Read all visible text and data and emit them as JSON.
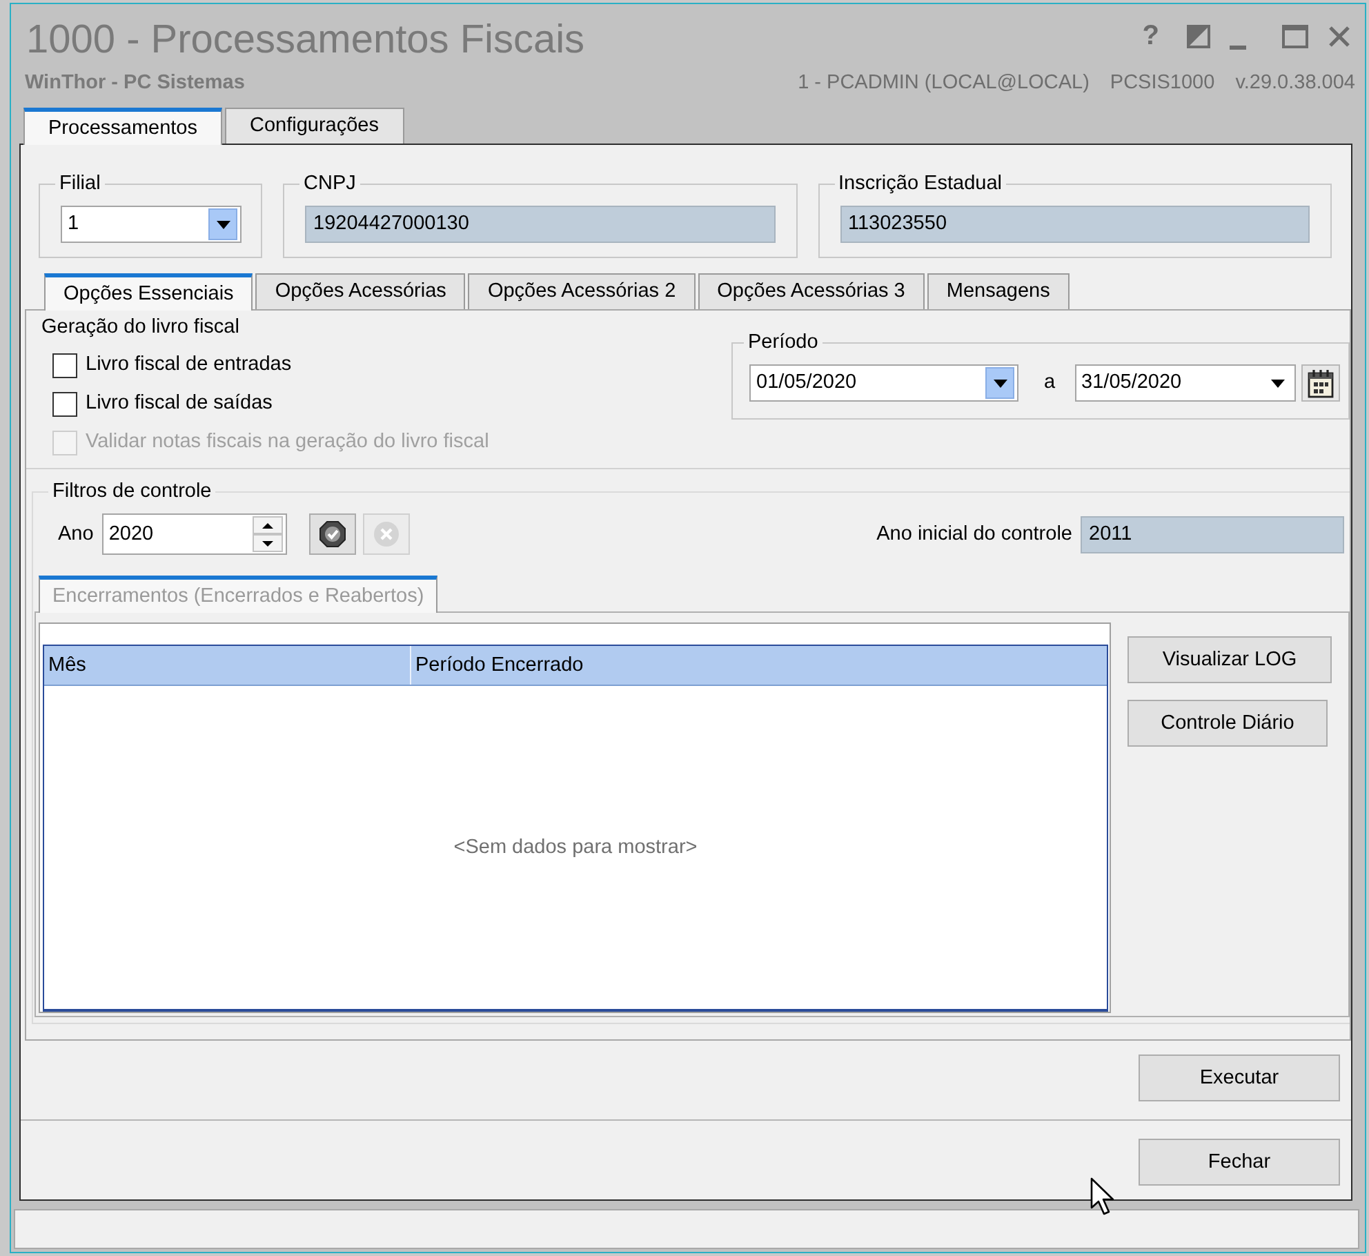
{
  "window": {
    "title": "1000 - Processamentos Fiscais",
    "subtitle": "WinThor - PC Sistemas",
    "user": "1 - PCADMIN (LOCAL@LOCAL)",
    "program": "PCSIS1000",
    "version": "v.29.0.38.004",
    "controls": [
      {
        "kind": "help",
        "label": "?"
      },
      {
        "kind": "mode"
      },
      {
        "kind": "minimize"
      },
      {
        "kind": "maximize"
      },
      {
        "kind": "close"
      }
    ]
  },
  "main_tabs": [
    {
      "label": "Processamentos",
      "selected": true
    },
    {
      "label": "Configurações",
      "selected": false
    }
  ],
  "header_fields": [
    {
      "label": "Filial",
      "kind": "dropdown",
      "value": "1",
      "highlighted": true
    },
    {
      "label": "CNPJ",
      "kind": "readonly",
      "value": "19204427000130"
    },
    {
      "label": "Inscrição Estadual",
      "kind": "readonly",
      "value": "113023550"
    }
  ],
  "option_tabs": [
    {
      "label": "Opções Essenciais",
      "selected": true
    },
    {
      "label": "Opções Acessórias",
      "selected": false
    },
    {
      "label": "Opções Acessórias 2",
      "selected": false
    },
    {
      "label": "Opções Acessórias 3",
      "selected": false
    },
    {
      "label": "Mensagens",
      "selected": false
    }
  ],
  "livro_fiscal": {
    "title": "Geração do livro fiscal",
    "options": [
      {
        "label": "Livro fiscal de entradas",
        "checked": false,
        "disabled": false
      },
      {
        "label": "Livro fiscal de saídas",
        "checked": false,
        "disabled": false
      },
      {
        "label": "Validar notas fiscais na geração do livro fiscal",
        "checked": false,
        "disabled": true
      }
    ]
  },
  "periodo": {
    "title": "Período",
    "start": {
      "value": "01/05/2020",
      "highlighted": true
    },
    "separator": "a",
    "end": {
      "value": "31/05/2020",
      "highlighted": false
    }
  },
  "filtros": {
    "title": "Filtros de controle",
    "year_label": "Ano",
    "year": "2020",
    "actions": [
      {
        "kind": "confirm",
        "disabled": false
      },
      {
        "kind": "cancel",
        "disabled": true
      }
    ],
    "initial_year_label": "Ano inicial do controle",
    "initial_year": "2011"
  },
  "encerramentos": {
    "tab": {
      "label": "Encerramentos (Encerrados e Reabertos)",
      "selected": true,
      "disabled": true
    },
    "columns": [
      "Mês",
      "Período Encerrado"
    ],
    "empty_text": "<Sem dados para mostrar>",
    "buttons": [
      "Visualizar LOG",
      "Controle Diário"
    ]
  },
  "footer_buttons": [
    "Executar",
    "Fechar"
  ]
}
